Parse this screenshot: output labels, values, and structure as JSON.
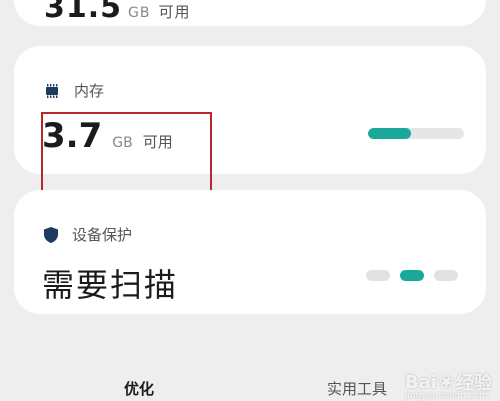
{
  "top_card": {
    "value": "31.5",
    "unit": "GB",
    "status": "可用"
  },
  "memory_card": {
    "title": "内存",
    "icon": "chip-icon",
    "value": "3.7",
    "unit": "GB",
    "status": "可用",
    "usage_fraction": 0.45,
    "accent": "#1aa89a"
  },
  "protection_card": {
    "title": "设备保护",
    "icon": "shield-icon",
    "status": "需要扫描",
    "page_count": 3,
    "active_page": 1
  },
  "tabs": [
    {
      "label": "优化",
      "active": true
    },
    {
      "label": "实用工具",
      "active": false
    }
  ],
  "watermark": {
    "text": "Bai",
    "suffix": "经验",
    "sub": "jingyan.baidu.com"
  },
  "highlight_color": "#b7282e"
}
